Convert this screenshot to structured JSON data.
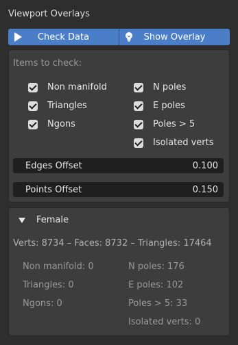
{
  "header": {
    "title": "Viewport Overlays"
  },
  "toolbar": {
    "check_label": "Check Data",
    "overlay_label": "Show Overlay"
  },
  "checks": {
    "section_label": "Items to check:",
    "left": [
      "Non manifold",
      "Triangles",
      "Ngons"
    ],
    "right": [
      "N poles",
      "E poles",
      "Poles > 5",
      "Isolated verts"
    ]
  },
  "offsets": {
    "edges_label": "Edges Offset",
    "edges_value": "0.100",
    "points_label": "Points Offset",
    "points_value": "0.150"
  },
  "object": {
    "name": "Female",
    "summary": "Verts: 8734 – Faces: 8732 – Triangles: 17464",
    "left_stats": [
      "Non manifold: 0",
      "Triangles: 0",
      "Ngons: 0"
    ],
    "right_stats": [
      "N poles: 176",
      "E poles: 102",
      "Poles > 5: 33",
      "Isolated verts: 0"
    ]
  },
  "colors": {
    "accent": "#4a7fc8",
    "panel": "#3d3d3d",
    "background": "#2e2e2e"
  }
}
